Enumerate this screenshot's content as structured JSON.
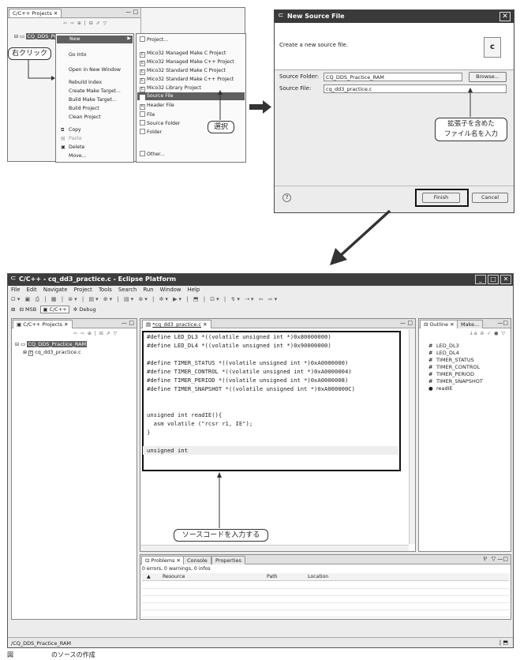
{
  "top_left": {
    "view_tab": "C/C++ Projects",
    "tree_root": "CQ_DDS_Pr",
    "context_menu": [
      "New",
      "Go Into",
      "Open in New Window",
      "Rebuild Index",
      "Create Make Target...",
      "Build Make Target...",
      "Build Project",
      "Clean Project",
      "Copy",
      "Paste",
      "Delete",
      "Move..."
    ],
    "submenu": [
      "Project...",
      "Mico32 Managed Make C Project",
      "Mico32 Managed Make C++ Project",
      "Mico32 Standard Make C Project",
      "Mico32 Standard Make C++ Project",
      "Mico32 Library Project",
      "Source File",
      "Header File",
      "File",
      "Source Folder",
      "Folder",
      "Other..."
    ],
    "callout_right_click": "右クリック",
    "callout_select": "選択"
  },
  "dialog": {
    "title": "New Source File",
    "description": "Create a new source file.",
    "source_folder_label": "Source Folder:",
    "source_folder_value": "CQ_DDS_Practice_RAM",
    "browse_label": "Browse...",
    "source_file_label": "Source File:",
    "source_file_value": "cq_dd3_practice.c",
    "callout_line1": "拡張子を含めた",
    "callout_line2": "ファイル名を入力",
    "help_glyph": "?",
    "finish_label": "Finish",
    "cancel_label": "Cancel"
  },
  "eclipse": {
    "title": "C/C++ - cq_dd3_practice.c - Eclipse Platform",
    "menubar": [
      "File",
      "Edit",
      "Navigate",
      "Project",
      "Tools",
      "Search",
      "Run",
      "Window",
      "Help"
    ],
    "perspectives": [
      "MSB",
      "C/C++",
      "Debug"
    ],
    "projects_tab": "C/C++ Projects",
    "tree_project": "CQ_DDS_Practice_RAM",
    "tree_file": "cq_dd3_practice.c",
    "editor_tab": "*cq_dd3_practice.c",
    "code_lines": [
      "#define LED_DL3 *((volatile unsigned int *)0x80000000)",
      "#define LED_DL4 *((volatile unsigned int *)0x90000000)",
      "",
      "#define TIMER_STATUS *((volatile unsigned int *)0xA0000000)",
      "#define TIMER_CONTROL *((volatile unsigned int *)0xA0000004)",
      "#define TIMER_PERIOD *((volatile unsigned int *)0xA0000008)",
      "#define TIMER_SNAPSHOT *((volatile unsigned int *)0xA000000C)",
      "",
      "",
      "unsigned int readIE(){",
      "  asm volatile (\"rcsr r1, IE\");",
      "}",
      "",
      "",
      "unsigned int"
    ],
    "callout_source": "ソースコードを入力する",
    "outline_tab": "Outline",
    "make_tab": "Make...",
    "outline_items": [
      "LED_DL3",
      "LED_DL4",
      "TIMER_STATUS",
      "TIMER_CONTROL",
      "TIMER_PERIOD",
      "TIMER_SNAPSHOT",
      "readIE"
    ],
    "bottom_tabs": [
      "Problems",
      "Console",
      "Properties"
    ],
    "problems_summary": "0 errors, 0 warnings, 0 infos",
    "problems_columns": [
      "Resource",
      "Path",
      "Location"
    ],
    "status_bar": "/CQ_DDS_Practice_RAM"
  },
  "caption": "図　　　　　　のソースの作成"
}
